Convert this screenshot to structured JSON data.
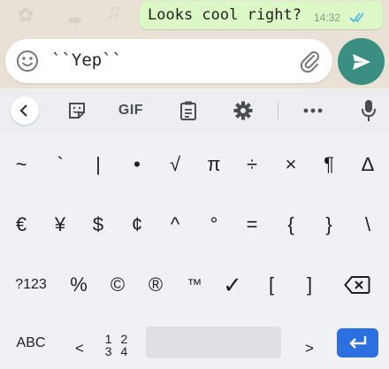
{
  "chat": {
    "message_text": "Looks cool right?",
    "message_time": "14:32",
    "tick_color": "#4fb3e8"
  },
  "composer": {
    "input_value": "``Yep``",
    "accent": "#3a8f82"
  },
  "toolbar": {
    "gif_label": "GIF",
    "icons": [
      "chevron-left-icon",
      "sticker-icon",
      "gif-icon",
      "clipboard-icon",
      "gear-icon",
      "more-icon",
      "mic-icon"
    ]
  },
  "keyboard": {
    "row1": [
      "~",
      "`",
      "|",
      "•",
      "√",
      "π",
      "÷",
      "×",
      "¶",
      "∆"
    ],
    "row2": [
      "€",
      "¥",
      "$",
      "¢",
      "^",
      "°",
      "=",
      "{",
      "}",
      "\\"
    ],
    "row3": [
      "?123",
      "%",
      "©",
      "®",
      "™",
      "✓",
      "[",
      "]"
    ],
    "row4": {
      "abc": "ABC",
      "lt": "<",
      "numpad_top": "1 2",
      "numpad_bottom": "3 4",
      "gt": ">"
    },
    "enter_color": "#2b6fe0"
  }
}
